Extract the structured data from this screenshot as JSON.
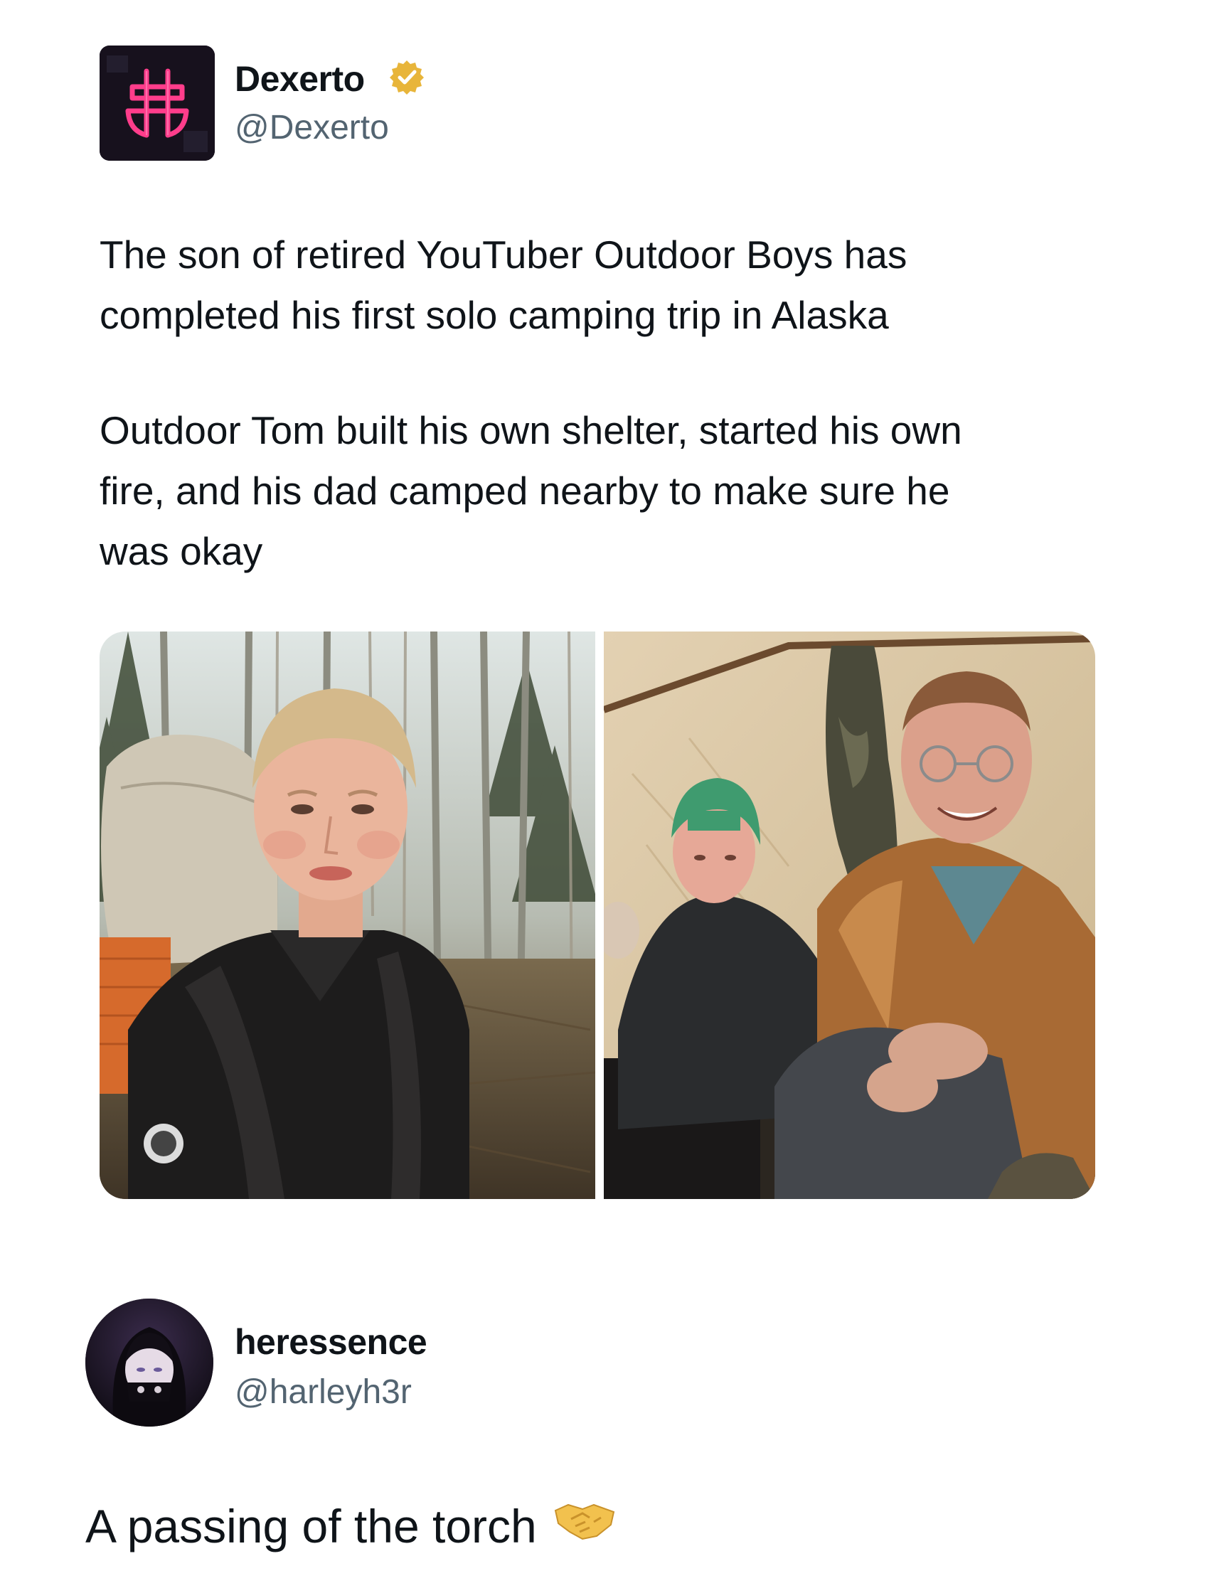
{
  "post": {
    "author": {
      "name": "Dexerto",
      "handle": "@Dexerto",
      "verified_color": "#e8b53a",
      "avatar_icon": "dexerto-logo-icon"
    },
    "text_paragraph_1_line_1": "The son of retired YouTuber Outdoor Boys has",
    "text_paragraph_1_line_2": "completed his first solo camping trip in Alaska",
    "text_paragraph_2_line_1": "Outdoor Tom built his own shelter, started his own",
    "text_paragraph_2_line_2": "fire, and his dad camped nearby to make sure he",
    "text_paragraph_2_line_3": "was okay",
    "media": [
      {
        "icon": "photo-boy-in-forest"
      },
      {
        "icon": "photo-father-and-son-in-tent"
      }
    ]
  },
  "reply": {
    "author": {
      "name": "heressence",
      "handle": "@harleyh3r",
      "avatar_icon": "user-avatar-icon"
    },
    "text": "A passing of the torch",
    "emoji_icon": "handshake-icon"
  },
  "colors": {
    "text": "#0f1419",
    "secondary": "#536471",
    "dexerto_pink": "#ff3d8b"
  }
}
